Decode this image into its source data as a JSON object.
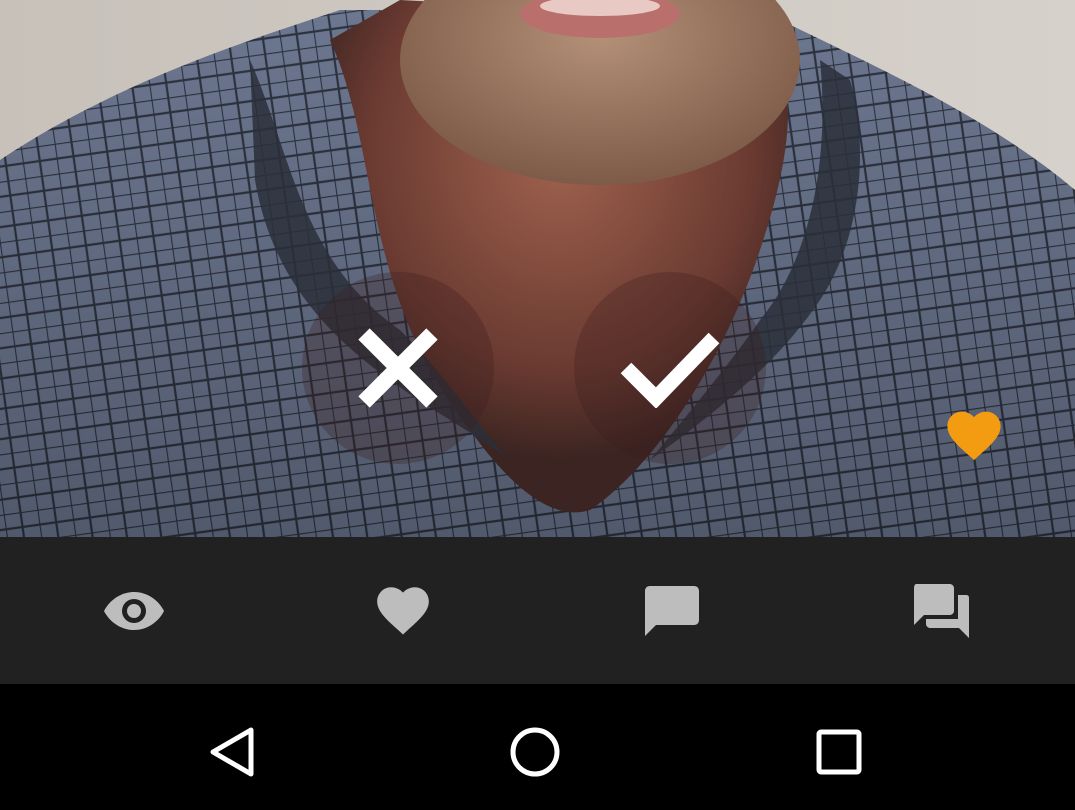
{
  "photo": {
    "description_icon": "profile-photo"
  },
  "actions": {
    "reject_icon": "close-icon",
    "accept_icon": "check-icon",
    "favorite_icon": "heart-icon",
    "favorite_color": "#F39C12"
  },
  "tabbar": {
    "background": "#212121",
    "icon_color": "#BDBDBD",
    "tabs": [
      {
        "icon": "eye-icon"
      },
      {
        "icon": "heart-icon"
      },
      {
        "icon": "chat-bubble-icon"
      },
      {
        "icon": "conversations-icon"
      }
    ]
  },
  "navbar": {
    "buttons": [
      {
        "icon": "back-triangle-icon"
      },
      {
        "icon": "home-circle-icon"
      },
      {
        "icon": "recents-square-icon"
      }
    ]
  }
}
